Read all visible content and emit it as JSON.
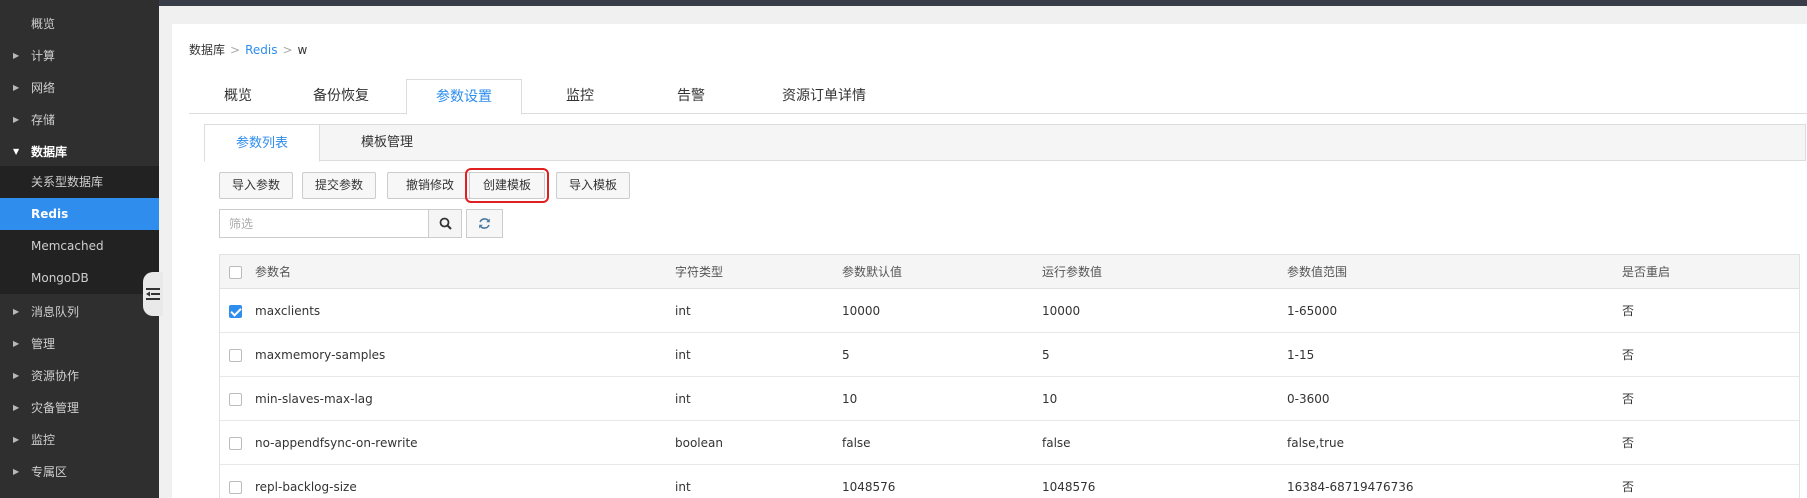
{
  "sidebar": {
    "items": [
      {
        "label": "概览",
        "caret": false
      },
      {
        "label": "计算",
        "caret": true
      },
      {
        "label": "网络",
        "caret": true
      },
      {
        "label": "存储",
        "caret": true
      },
      {
        "label": "数据库",
        "caret": true,
        "open": true
      },
      {
        "label": "关系型数据库",
        "sub": true
      },
      {
        "label": "Redis",
        "sub": true,
        "active": true
      },
      {
        "label": "Memcached",
        "sub": true
      },
      {
        "label": "MongoDB",
        "sub": true
      },
      {
        "label": "消息队列",
        "caret": true
      },
      {
        "label": "管理",
        "caret": true
      },
      {
        "label": "资源协作",
        "caret": true
      },
      {
        "label": "灾备管理",
        "caret": true
      },
      {
        "label": "监控",
        "caret": true
      },
      {
        "label": "专属区",
        "caret": true
      }
    ]
  },
  "breadcrumb": {
    "root": "数据库",
    "parent": "Redis",
    "current": "w",
    "separator": ">"
  },
  "tabs": [
    "概览",
    "备份恢复",
    "参数设置",
    "监控",
    "告警",
    "资源订单详情"
  ],
  "active_tab": "参数设置",
  "subtabs": [
    "参数列表",
    "模板管理"
  ],
  "active_subtab": "参数列表",
  "toolbar": {
    "buttons": [
      "导入参数",
      "提交参数",
      "撤销修改",
      "创建模板",
      "导入模板"
    ],
    "highlighted": "创建模板"
  },
  "filter": {
    "placeholder": "筛选",
    "value": ""
  },
  "table": {
    "columns": [
      "参数名",
      "字符类型",
      "参数默认值",
      "运行参数值",
      "参数值范围",
      "是否重启"
    ],
    "rows": [
      {
        "checked": true,
        "cells": [
          "maxclients",
          "int",
          "10000",
          "10000",
          "1-65000",
          "否"
        ]
      },
      {
        "checked": false,
        "cells": [
          "maxmemory-samples",
          "int",
          "5",
          "5",
          "1-15",
          "否"
        ]
      },
      {
        "checked": false,
        "cells": [
          "min-slaves-max-lag",
          "int",
          "10",
          "10",
          "0-3600",
          "否"
        ]
      },
      {
        "checked": false,
        "cells": [
          "no-appendfsync-on-rewrite",
          "boolean",
          "false",
          "false",
          "false,true",
          "否"
        ]
      },
      {
        "checked": false,
        "cells": [
          "repl-backlog-size",
          "int",
          "1048576",
          "1048576",
          "16384-68719476736",
          "否"
        ]
      }
    ]
  },
  "colors": {
    "accent": "#2e8ded",
    "sidebar_bg": "#2f2f2f",
    "highlight_border": "#e02020"
  }
}
